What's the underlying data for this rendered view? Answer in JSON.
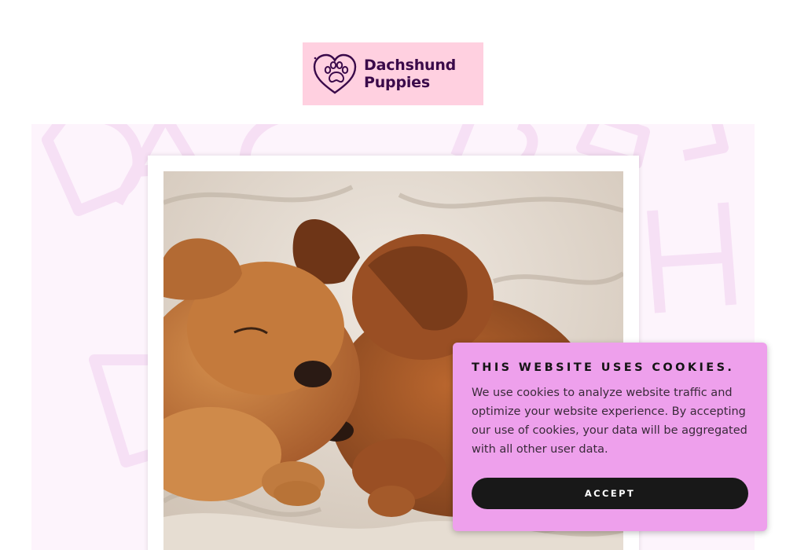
{
  "header": {
    "logo_line1": "Dachshund",
    "logo_line2": "Puppies",
    "logo_icon": "heart-paw-icon"
  },
  "hero": {
    "watermark": "DACHSHUND PUPPIES",
    "photo_subject": "two sleeping dachshund puppies on a blanket"
  },
  "cookie_banner": {
    "title": "THIS WEBSITE USES COOKIES.",
    "body": "We use cookies to analyze website traffic and optimize your website experience. By accepting our use of cookies, your data will be aggregated with all other user data.",
    "accept_label": "ACCEPT"
  },
  "colors": {
    "logo_bg": "#ffd0e0",
    "brand_text": "#3a0a4a",
    "hero_bg": "#fdf4fc",
    "cookie_bg": "#eea0ec",
    "button_bg": "#181818"
  }
}
